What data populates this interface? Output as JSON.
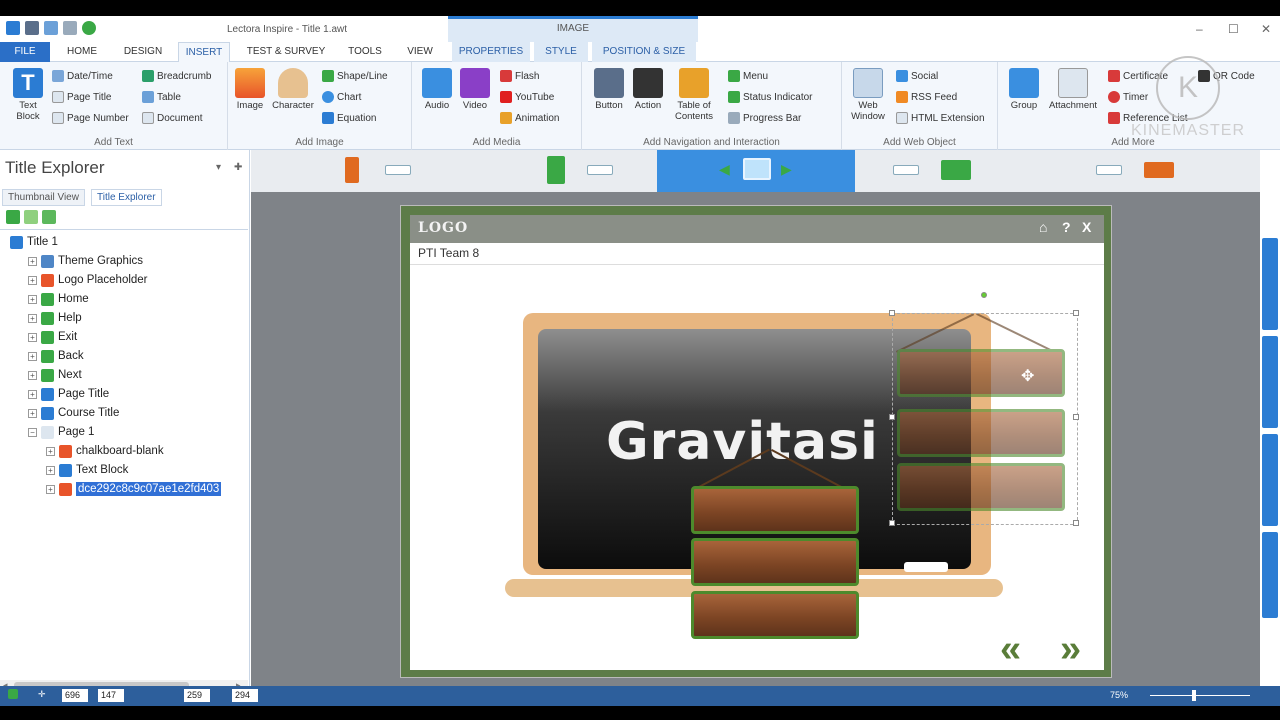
{
  "window": {
    "title": "Lectora Inspire - Title 1.awt",
    "context_group": "IMAGE"
  },
  "tabs": [
    "FILE",
    "HOME",
    "DESIGN",
    "INSERT",
    "TEST & SURVEY",
    "TOOLS",
    "VIEW",
    "PROPERTIES",
    "STYLE",
    "POSITION & SIZE"
  ],
  "active_tab": "INSERT",
  "ribbon": {
    "add_text": {
      "label": "Add Text",
      "text_block": "Text Block",
      "date_time": "Date/Time",
      "page_title": "Page Title",
      "page_number": "Page Number",
      "breadcrumb": "Breadcrumb",
      "table": "Table",
      "document": "Document"
    },
    "add_image": {
      "label": "Add Image",
      "image": "Image",
      "character": "Character",
      "shape_line": "Shape/Line",
      "chart": "Chart",
      "equation": "Equation"
    },
    "add_media": {
      "label": "Add Media",
      "audio": "Audio",
      "video": "Video",
      "flash": "Flash",
      "youtube": "YouTube",
      "animation": "Animation"
    },
    "add_nav": {
      "label": "Add Navigation and Interaction",
      "button": "Button",
      "action": "Action",
      "toc": "Table of Contents",
      "menu": "Menu",
      "status_indicator": "Status Indicator",
      "progress_bar": "Progress Bar"
    },
    "add_web": {
      "label": "Add Web Object",
      "web_window": "Web Window",
      "social": "Social",
      "rss_feed": "RSS Feed",
      "html_extension": "HTML Extension"
    },
    "add_more": {
      "label": "Add More",
      "group": "Group",
      "attachment": "Attachment",
      "certificate": "Certificate",
      "timer": "Timer",
      "reference_list": "Reference List",
      "qr_code": "QR Code"
    }
  },
  "left_panel": {
    "title": "Title Explorer",
    "tabs": [
      "Thumbnail View",
      "Title Explorer"
    ],
    "tree": [
      {
        "label": "Title 1",
        "icon": "title-icon",
        "color": "#2b7cd3"
      },
      {
        "label": "Theme Graphics",
        "icon": "theme-icon",
        "color": "#4f86c6"
      },
      {
        "label": "Logo Placeholder",
        "icon": "image-icon",
        "color": "#e8542a"
      },
      {
        "label": "Home",
        "icon": "button-icon",
        "color": "#3aa845"
      },
      {
        "label": "Help",
        "icon": "button-icon",
        "color": "#3aa845"
      },
      {
        "label": "Exit",
        "icon": "button-icon",
        "color": "#3aa845"
      },
      {
        "label": "Back",
        "icon": "button-icon",
        "color": "#3aa845"
      },
      {
        "label": "Next",
        "icon": "button-icon",
        "color": "#3aa845"
      },
      {
        "label": "Page Title",
        "icon": "text-icon",
        "color": "#2b7cd3"
      },
      {
        "label": "Course Title",
        "icon": "text-icon",
        "color": "#2b7cd3"
      },
      {
        "label": "Page 1",
        "icon": "page-icon",
        "color": "#dde6ef"
      },
      {
        "label": "chalkboard-blank",
        "icon": "image-icon",
        "color": "#e8542a"
      },
      {
        "label": "Text Block",
        "icon": "text-icon",
        "color": "#2b7cd3"
      },
      {
        "label": "dce292c8c9c07ae1e2fd403",
        "icon": "image-icon",
        "color": "#e8542a"
      }
    ]
  },
  "canvas": {
    "logo": "LOGO",
    "page_title": "PTI Team 8",
    "heading": "Gravitasi",
    "home_icon": "⌂",
    "help_icon": "?",
    "close_icon": "X",
    "back_arrows": "«",
    "next_arrows": "»"
  },
  "statusbar": {
    "x": "696",
    "y": "147",
    "w": "259",
    "h": "294",
    "zoom": "75%"
  },
  "watermark": {
    "text": "KINEMASTER",
    "logo": "K"
  },
  "colors": {
    "accent": "#2b7cd3",
    "ribbon_bg": "#f3f7fc",
    "status_bg": "#2d5f9c",
    "selection": "#3170d6"
  }
}
